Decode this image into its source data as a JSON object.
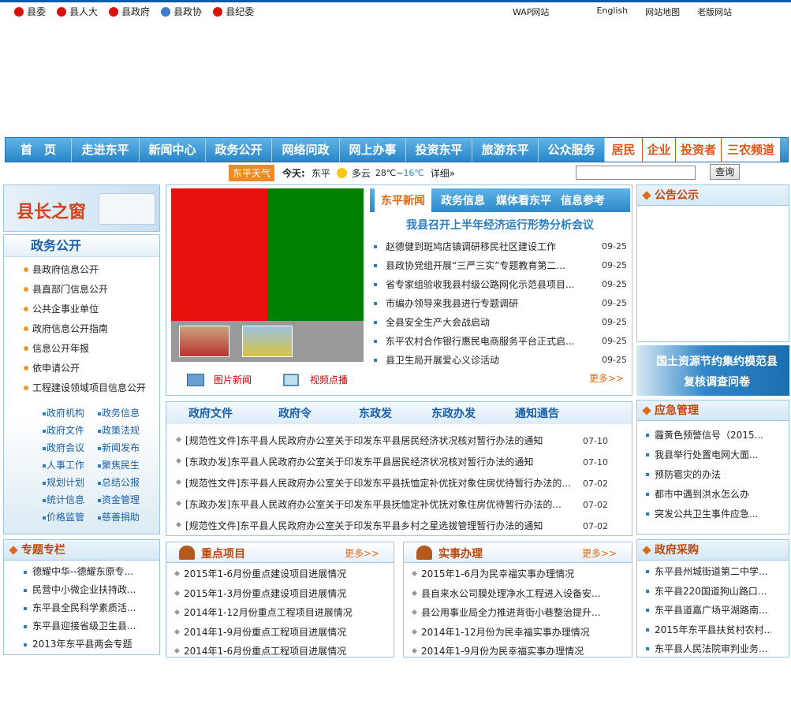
{
  "top": {
    "links": [
      "县委",
      "县人大",
      "县政府",
      "县政协",
      "县纪委"
    ],
    "right": [
      "WAP网站",
      "English",
      "网站地图",
      "老版网站"
    ]
  },
  "nav": {
    "main": [
      "首　页",
      "走进东平",
      "新闻中心",
      "政务公开",
      "网络问政",
      "网上办事",
      "投资东平",
      "旅游东平",
      "公众服务"
    ],
    "side": [
      "居民",
      "企业",
      "投资者",
      "三农频道"
    ]
  },
  "weather": {
    "badge": "东平天气",
    "today": "今天:",
    "city": "东平",
    "cond": "多云",
    "temp_hi": "28℃",
    "sep": "~",
    "temp_lo": "16℃",
    "detail": "详细»",
    "search_btn": "查询"
  },
  "mayor": {
    "title": "县长之窗"
  },
  "gov_open": {
    "title": "政务公开",
    "items": [
      "县政府信息公开",
      "县直部门信息公开",
      "公共企事业单位",
      "政府信息公开指南",
      "信息公开年报",
      "依申请公开",
      "工程建设领域项目信息公开"
    ],
    "grid": [
      "政府机构",
      "政务信息",
      "政府文件",
      "政策法规",
      "政府会议",
      "新闻发布",
      "人事工作",
      "聚焦民生",
      "规划计划",
      "总结公报",
      "统计信息",
      "资金管理",
      "价格监管",
      "慈善捐助"
    ]
  },
  "topics": {
    "title": "专题专栏",
    "items": [
      "德耀中华--德耀东原专...",
      "民营中小微企业扶持政...",
      "东平县全民科学素质活...",
      "东平县迎接省级卫生县...",
      "2013年东平县两会专题"
    ]
  },
  "news": {
    "tabs": [
      "东平新闻",
      "政务信息",
      "媒体看东平",
      "信息参考"
    ],
    "headline": "我县召开上半年经济运行形势分析会议",
    "items": [
      {
        "t": "赵德健到斑鸠店镇调研移民社区建设工作",
        "d": "09-25"
      },
      {
        "t": "县政协党组开展“三严三实”专题教育第二...",
        "d": "09-25"
      },
      {
        "t": "省专家组验收我县村级公路网化示范县项目...",
        "d": "09-25"
      },
      {
        "t": "市编办领导来我县进行专题调研",
        "d": "09-25"
      },
      {
        "t": "全县安全生产大会战启动",
        "d": "09-25"
      },
      {
        "t": "东平农村合作银行惠民电商服务平台正式启...",
        "d": "09-25"
      },
      {
        "t": "县卫生局开展爱心义诊活动",
        "d": "09-25"
      }
    ],
    "more": "更多>>",
    "photo": "图片新闻",
    "video": "视频点播"
  },
  "docs": {
    "tabs": [
      "政府文件",
      "政府令",
      "东政发",
      "东政办发",
      "通知通告"
    ],
    "items": [
      {
        "t": "[规范性文件]东平县人民政府办公室关于印发东平县居民经济状况核对暂行办法的通知",
        "d": "07-10"
      },
      {
        "t": "[东政办发]东平县人民政府办公室关于印发东平县居民经济状况核对暂行办法的通知",
        "d": "07-10"
      },
      {
        "t": "[规范性文件]东平县人民政府办公室关于印发东平县抚恤定补优抚对象住房优待暂行办法的...",
        "d": "07-02"
      },
      {
        "t": "[东政办发]东平县人民政府办公室关于印发东平县抚恤定补优抚对象住房优待暂行办法的...",
        "d": "07-02"
      },
      {
        "t": "[规范性文件]东平县人民政府办公室关于印发东平县乡村之星选拔管理暂行办法的通知",
        "d": "07-02"
      }
    ]
  },
  "key_proj": {
    "title": "重点项目",
    "more": "更多>>",
    "items": [
      "2015年1-6月份重点建设项目进展情况",
      "2015年1-3月份重点建设项目进展情况",
      "2014年1-12月份重点工程项目进展情况",
      "2014年1-9月份重点工程项目进展情况",
      "2014年1-6月份重点工程项目进展情况"
    ]
  },
  "practical": {
    "title": "实事办理",
    "more": "更多>>",
    "items": [
      "2015年1-6月为民幸福实事办理情况",
      "县自来水公司膜处理净水工程进入设备安...",
      "县公用事业局全力推进背街小巷整治提升...",
      "2014年1-12月份为民幸福实事办理情况",
      "2014年1-9月份为民幸福实事办理情况"
    ]
  },
  "notice": {
    "title": "公告公示"
  },
  "banner": {
    "line1": "国土资源节约集约模范县",
    "line2": "复核调查问卷"
  },
  "emergency": {
    "title": "应急管理",
    "items": [
      "霾黄色预警信号（2015...",
      "我县举行处置电网大面...",
      "预防雹灾的办法",
      "都市中遇到洪水怎么办",
      "突发公共卫生事件应急..."
    ]
  },
  "procure": {
    "title": "政府采购",
    "items": [
      "东平县州城街道第二中学...",
      "东平县220国道狗山路口...",
      "东平县道嘉广场平湖路南...",
      "2015年东平县扶贫村农村...",
      "东平县人民法院审判业务..."
    ]
  },
  "colors": {
    "nav": "#2a86c9",
    "accent": "#e0521a",
    "link": "#1a5fa8"
  }
}
